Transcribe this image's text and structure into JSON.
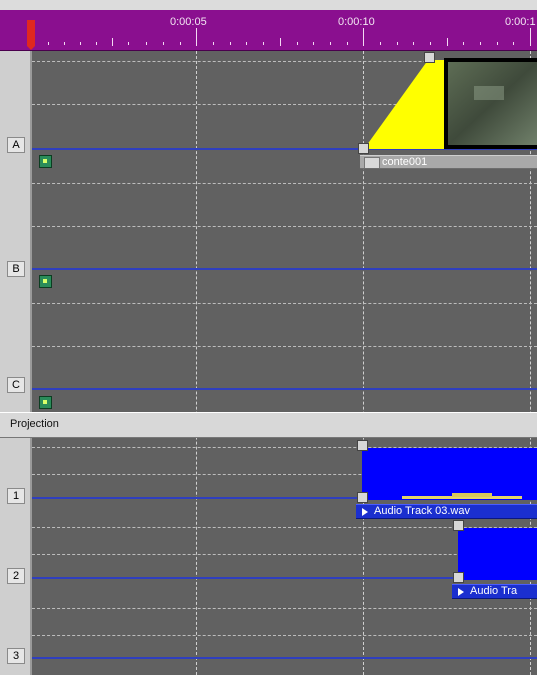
{
  "ruler": {
    "time_labels": [
      "0:00:05",
      "0:00:10",
      "0:00:1"
    ]
  },
  "tracks": {
    "video": [
      {
        "letter": "A"
      },
      {
        "letter": "B"
      },
      {
        "letter": "C"
      }
    ],
    "section_label": "Projection",
    "audio": [
      {
        "letter": "1"
      },
      {
        "letter": "2"
      },
      {
        "letter": "3"
      }
    ]
  },
  "clips": {
    "video_clip_name": "conte001",
    "audio_clip_1": "Audio Track 03.wav",
    "audio_clip_2": "Audio Tra"
  },
  "colors": {
    "ruler": "#8a0f8f",
    "track_bg": "#616161",
    "track_line": "#2f3fbf",
    "audio_block": "#0000ff",
    "transition": "#ffff00",
    "playhead": "#e0281f"
  }
}
